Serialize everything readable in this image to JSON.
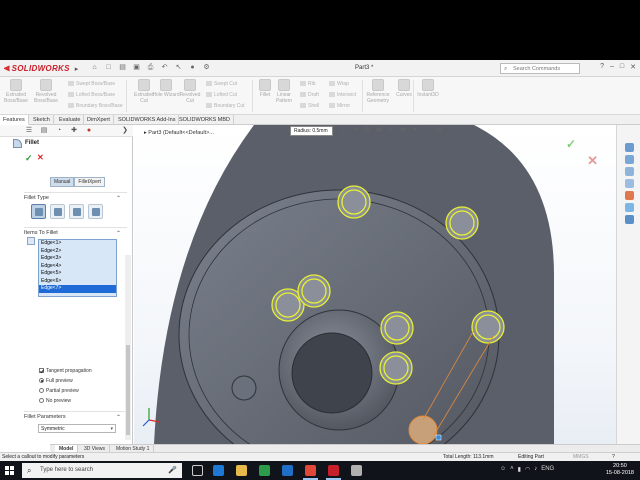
{
  "app": {
    "logo_text": "SOLIDWORKS",
    "doc_title": "Part3 *",
    "search_placeholder": "Search Commands"
  },
  "commands": {
    "big": [
      {
        "label": "Extruded Boss/Base",
        "icon": "extrude-icon"
      },
      {
        "label": "Revolved Boss/Base",
        "icon": "revolve-icon"
      },
      {
        "label": "Extruded Cut",
        "icon": "extruded-cut-icon"
      },
      {
        "label": "Hole Wizard",
        "icon": "hole-wizard-icon"
      },
      {
        "label": "Revolved Cut",
        "icon": "revolved-cut-icon"
      },
      {
        "label": "Fillet",
        "icon": "fillet-icon"
      },
      {
        "label": "Linear Pattern",
        "icon": "linear-pattern-icon"
      },
      {
        "label": "Reference Geometry",
        "icon": "reference-geometry-icon"
      },
      {
        "label": "Curves",
        "icon": "curves-icon"
      },
      {
        "label": "Instant3D",
        "icon": "instant3d-icon"
      }
    ],
    "small1": [
      "Swept Boss/Base",
      "Lofted Boss/Base",
      "Boundary Boss/Base"
    ],
    "small2": [
      "Swept Cut",
      "Lofted Cut",
      "Boundary Cut"
    ],
    "small3": [
      "Rib",
      "Draft",
      "Shell"
    ],
    "small4": [
      "Wrap",
      "Intersect",
      "Mirror"
    ]
  },
  "tabs": [
    "Features",
    "Sketch",
    "Evaluate",
    "DimXpert",
    "SOLIDWORKS Add-Ins",
    "SOLIDWORKS MBD"
  ],
  "property_manager": {
    "title": "Fillet",
    "mode_tabs": [
      "Manual",
      "FilletXpert"
    ],
    "fillet_type_label": "Fillet Type",
    "items_label": "Items To Fillet",
    "edges": [
      "Edge<1>",
      "Edge<2>",
      "Edge<3>",
      "Edge<4>",
      "Edge<5>",
      "Edge<6>",
      "Edge<7>"
    ],
    "selected_edge": "Edge<7>",
    "tangent_propagation": "Tangent propagation",
    "preview_options": [
      "Full preview",
      "Partial preview",
      "No preview"
    ],
    "preview_selected": "Full preview",
    "params_label": "Fillet Parameters",
    "symmetric": "Symmetric"
  },
  "viewport": {
    "tree_item": "Part3 (Default<<Default>...",
    "distance": "Radius: 0.5mm"
  },
  "bottom_tabs": [
    "Model",
    "3D Views",
    "Motion Study 1"
  ],
  "status": {
    "hint": "Select a callout to modify parameters",
    "length": "Total Length: 113.1mm",
    "mode": "Editing Part",
    "units": "MMGS"
  },
  "taskbar": {
    "search": "Type here to search",
    "lang": "ENG",
    "time": "20:50",
    "date": "15-08-2018"
  },
  "colors": {
    "part": "#5f6470",
    "edge_highlight": "#e8f034",
    "preview": "#e08a3c",
    "accent": "#1e6ad6"
  }
}
